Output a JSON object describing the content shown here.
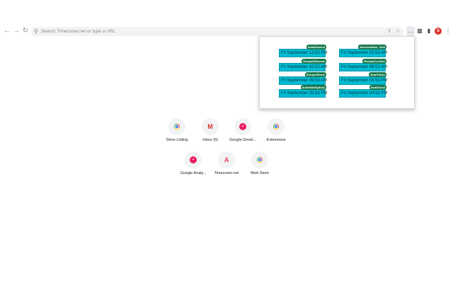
{
  "toolbar": {
    "back_icon": "arrow-left-icon",
    "forward_icon": "arrow-right-icon",
    "reload_icon": "reload-icon",
    "omnibox_placeholder": "Search Timeconer.net or type a URL",
    "share_icon": "share-icon",
    "bookmark_icon": "star-icon",
    "extension_icon": "ellipsis-icon",
    "puzzle_icon": "puzzle-icon",
    "sidepanel_icon": "side-panel-icon",
    "avatar_letter": "S",
    "menu_icon": "kebab-icon"
  },
  "popup": {
    "clocks": [
      {
        "time": "Fri September 12:53 PM",
        "timezone": "Asia/Karachi"
      },
      {
        "time": "Fri September 03:53 AM",
        "timezone": "America/New_York"
      },
      {
        "time": "Fri September 10:53 AM",
        "timezone": "Europe/Moscow"
      },
      {
        "time": "Fri September 08:53 AM",
        "timezone": "Europe/London"
      },
      {
        "time": "Fri September 09:53 AM",
        "timezone": "Europe/Rome"
      },
      {
        "time": "Fri September 04:53 PM",
        "timezone": "Asia/Tokyo"
      },
      {
        "time": "Fri September 05:53 PM",
        "timezone": "Australia/Sydney"
      },
      {
        "time": "Fri September 04:53 PM",
        "timezone": "Asia/Seoul"
      }
    ]
  },
  "shortcuts": [
    {
      "label": "Store Listing",
      "icon": "chrome-icon"
    },
    {
      "label": "Inbox (6)",
      "icon": "gmail-icon"
    },
    {
      "label": "Google Devel...",
      "icon": "google-developers-icon"
    },
    {
      "label": "Extensions",
      "icon": "chrome-icon"
    },
    {
      "label": "Google Analy...",
      "icon": "google-developers-icon"
    },
    {
      "label": "Timeconer.net",
      "icon": "timeconer-icon"
    },
    {
      "label": "Web Store",
      "icon": "chrome-icon"
    }
  ],
  "colors": {
    "clock_bg": "#00bcd4",
    "timezone_badge": "#1a7a4e",
    "avatar": "#d93025"
  }
}
